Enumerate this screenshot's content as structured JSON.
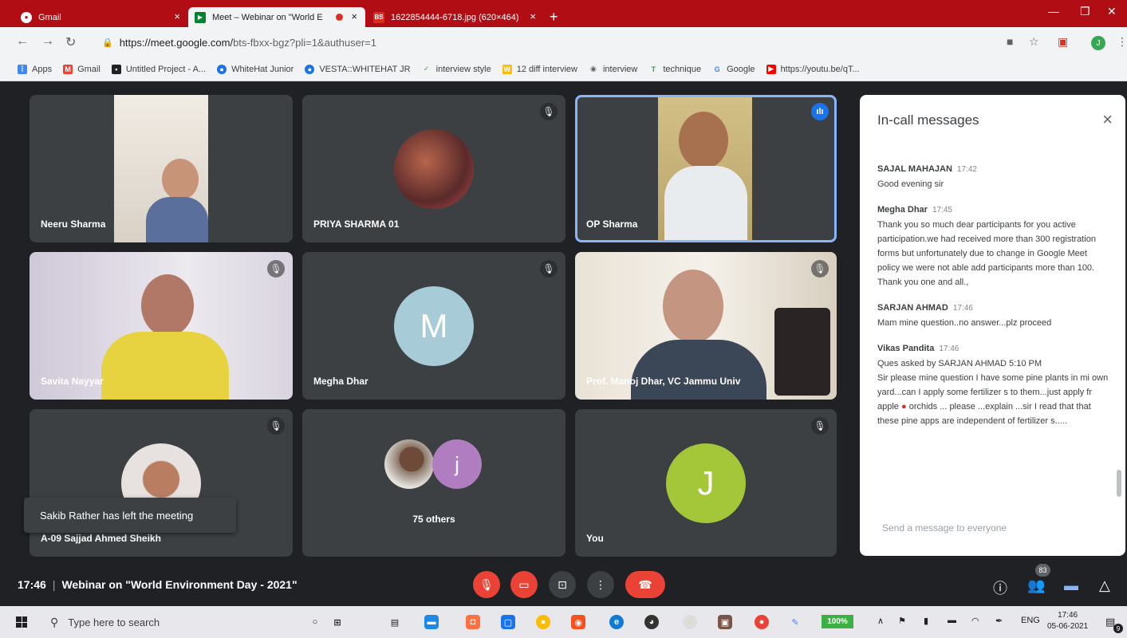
{
  "browser": {
    "tabs": [
      {
        "label": "Gmail",
        "icon": "chrome-icon"
      },
      {
        "label": "Meet – Webinar on \"World E",
        "icon": "meet-icon"
      },
      {
        "label": "1622854444-6718.jpg (620×464)",
        "icon": "bs-icon"
      }
    ],
    "new_tab": "+",
    "url_host": "https://meet.google.com/",
    "url_path": "bts-fbxx-bgz?pli=1&authuser=1",
    "profile_initial": "J"
  },
  "bookmarks": [
    {
      "label": "Apps",
      "icon": "apps-grid-icon",
      "color": "#4285f4"
    },
    {
      "label": "Gmail",
      "icon": "gmail-icon",
      "color": "#ea4335"
    },
    {
      "label": "Untitled Project - A...",
      "icon": "project-icon",
      "color": "#202124"
    },
    {
      "label": "WhiteHat Junior",
      "icon": "whitehat-icon",
      "color": "#1a73e8"
    },
    {
      "label": "VESTA::WHITEHAT JR",
      "icon": "whitehat-icon",
      "color": "#1a73e8"
    },
    {
      "label": "interview style",
      "icon": "check-icon",
      "color": "#34a853"
    },
    {
      "label": "12 diff interview",
      "icon": "w-icon",
      "color": "#fbbc04"
    },
    {
      "label": "interview",
      "icon": "wifi-icon",
      "color": "#5f6368"
    },
    {
      "label": "technique",
      "icon": "t-icon",
      "color": "#34a853"
    },
    {
      "label": "Google",
      "icon": "google-icon",
      "color": "#4285f4"
    },
    {
      "label": "https://youtu.be/qT...",
      "icon": "youtube-icon",
      "color": "#ff0000"
    }
  ],
  "participants": {
    "neeru": "Neeru Sharma",
    "priya": "PRIYA SHARMA 01",
    "op": "OP Sharma",
    "savita": "Savita Nayyar",
    "megha": "Megha Dhar",
    "megha_initial": "M",
    "manoj": "Prof. Manoj Dhar, VC Jammu Univ",
    "sajjad": "A-09 Sajjad Ahmed Sheikh",
    "others": "75 others",
    "others_initial": "j",
    "you": "You",
    "you_initial": "J"
  },
  "toast": "Sakib Rather has left the meeting",
  "chat": {
    "title": "In-call messages",
    "close": "×",
    "messages": [
      {
        "sender": "SAJAL MAHAJAN",
        "time": "17:42",
        "text": "Good evening sir"
      },
      {
        "sender": "Megha Dhar",
        "time": "17:45",
        "text": "Thank you so much dear participants for you active participation.we had received more than 300 registration forms but unfortunately due to change in Google Meet policy we were not able add participants more than 100.",
        "text2": "Thank you one and all.,"
      },
      {
        "sender": "SARJAN AHMAD",
        "time": "17:46",
        "text": "Mam mine question..no answer...plz proceed"
      },
      {
        "sender": "Vikas Pandita",
        "time": "17:46",
        "text": "Ques asked by SARJAN AHMAD 5:10 PM",
        "text2a": "Sir please mine question I have some pine plants in mi own yard...can I apply some fertilizer s to them...just apply fr apple",
        "text2b": "orchids ... please ...explain ...sir I read that that these pine apps are independent of fertilizer s....."
      }
    ],
    "input_placeholder": "Send a message to everyone"
  },
  "meeting": {
    "time": "17:46",
    "divider": "|",
    "title": "Webinar on \"World Environment Day - 2021\"",
    "participant_count": "83"
  },
  "taskbar": {
    "search_placeholder": "Type here to search",
    "battery": "100%",
    "lang": "ENG",
    "clock_time": "17:46",
    "clock_date": "05-06-2021",
    "notif_count": "9"
  }
}
